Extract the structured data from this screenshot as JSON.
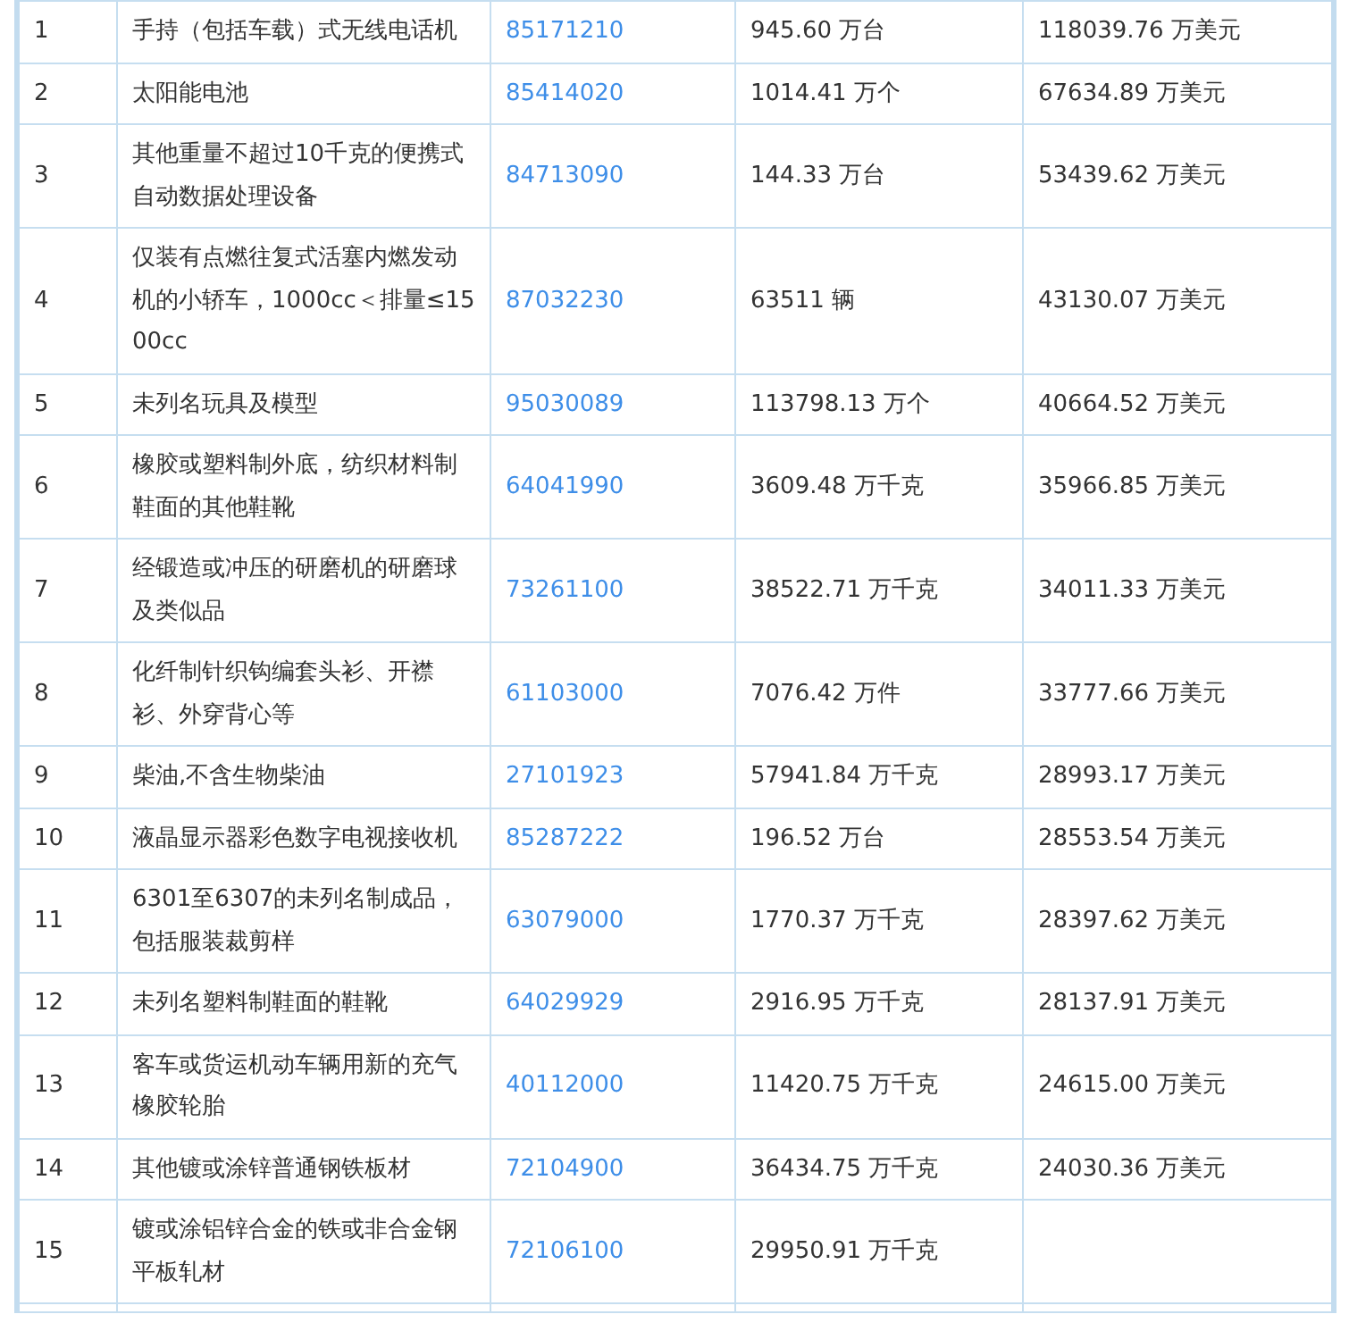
{
  "table": {
    "rows": [
      {
        "number": "1",
        "product": "手持（包括车载）式无线电话机",
        "code": "85171210",
        "quantity": "945.60 万台",
        "amount": "118039.76 万美元"
      },
      {
        "number": "2",
        "product": "太阳能电池",
        "code": "85414020",
        "quantity": "1014.41 万个",
        "amount": "67634.89 万美元"
      },
      {
        "number": "3",
        "product": "其他重量不超过10千克的便携式自动数据处理设备",
        "code": "84713090",
        "quantity": "144.33 万台",
        "amount": "53439.62 万美元"
      },
      {
        "number": "4",
        "product": "仅装有点燃往复式活塞内燃发动机的小轿车，1000cc＜排量≤1500cc",
        "code": "87032230",
        "quantity": "63511 辆",
        "amount": "43130.07 万美元"
      },
      {
        "number": "5",
        "product": "未列名玩具及模型",
        "code": "95030089",
        "quantity": "113798.13 万个",
        "amount": "40664.52 万美元"
      },
      {
        "number": "6",
        "product": "橡胶或塑料制外底，纺织材料制鞋面的其他鞋靴",
        "code": "64041990",
        "quantity": "3609.48 万千克",
        "amount": "35966.85 万美元"
      },
      {
        "number": "7",
        "product": "经锻造或冲压的研磨机的研磨球及类似品",
        "code": "73261100",
        "quantity": "38522.71 万千克",
        "amount": "34011.33 万美元"
      },
      {
        "number": "8",
        "product": "化纤制针织钩编套头衫、开襟衫、外穿背心等",
        "code": "61103000",
        "quantity": "7076.42 万件",
        "amount": "33777.66 万美元"
      },
      {
        "number": "9",
        "product": "柴油,不含生物柴油",
        "code": "27101923",
        "quantity": "57941.84 万千克",
        "amount": "28993.17 万美元"
      },
      {
        "number": "10",
        "product": "液晶显示器彩色数字电视接收机",
        "code": "85287222",
        "quantity": "196.52 万台",
        "amount": "28553.54 万美元"
      },
      {
        "number": "11",
        "product": "6301至6307的未列名制成品，包括服装裁剪样",
        "code": "63079000",
        "quantity": "1770.37 万千克",
        "amount": "28397.62 万美元"
      },
      {
        "number": "12",
        "product": "未列名塑料制鞋面的鞋靴",
        "code": "64029929",
        "quantity": "2916.95 万千克",
        "amount": "28137.91 万美元"
      },
      {
        "number": "13",
        "product": "客车或货运机动车辆用新的充气橡胶轮胎",
        "code": "40112000",
        "quantity": "11420.75 万千克",
        "amount": "24615.00 万美元"
      },
      {
        "number": "14",
        "product": "其他镀或涂锌普通钢铁板材",
        "code": "72104900",
        "quantity": "36434.75 万千克",
        "amount": "24030.36 万美元"
      },
      {
        "number": "15",
        "product": "镀或涂铝锌合金的铁或非合金钢平板轧材",
        "code": "72106100",
        "quantity": "29950.91 万千克"
      }
    ]
  }
}
